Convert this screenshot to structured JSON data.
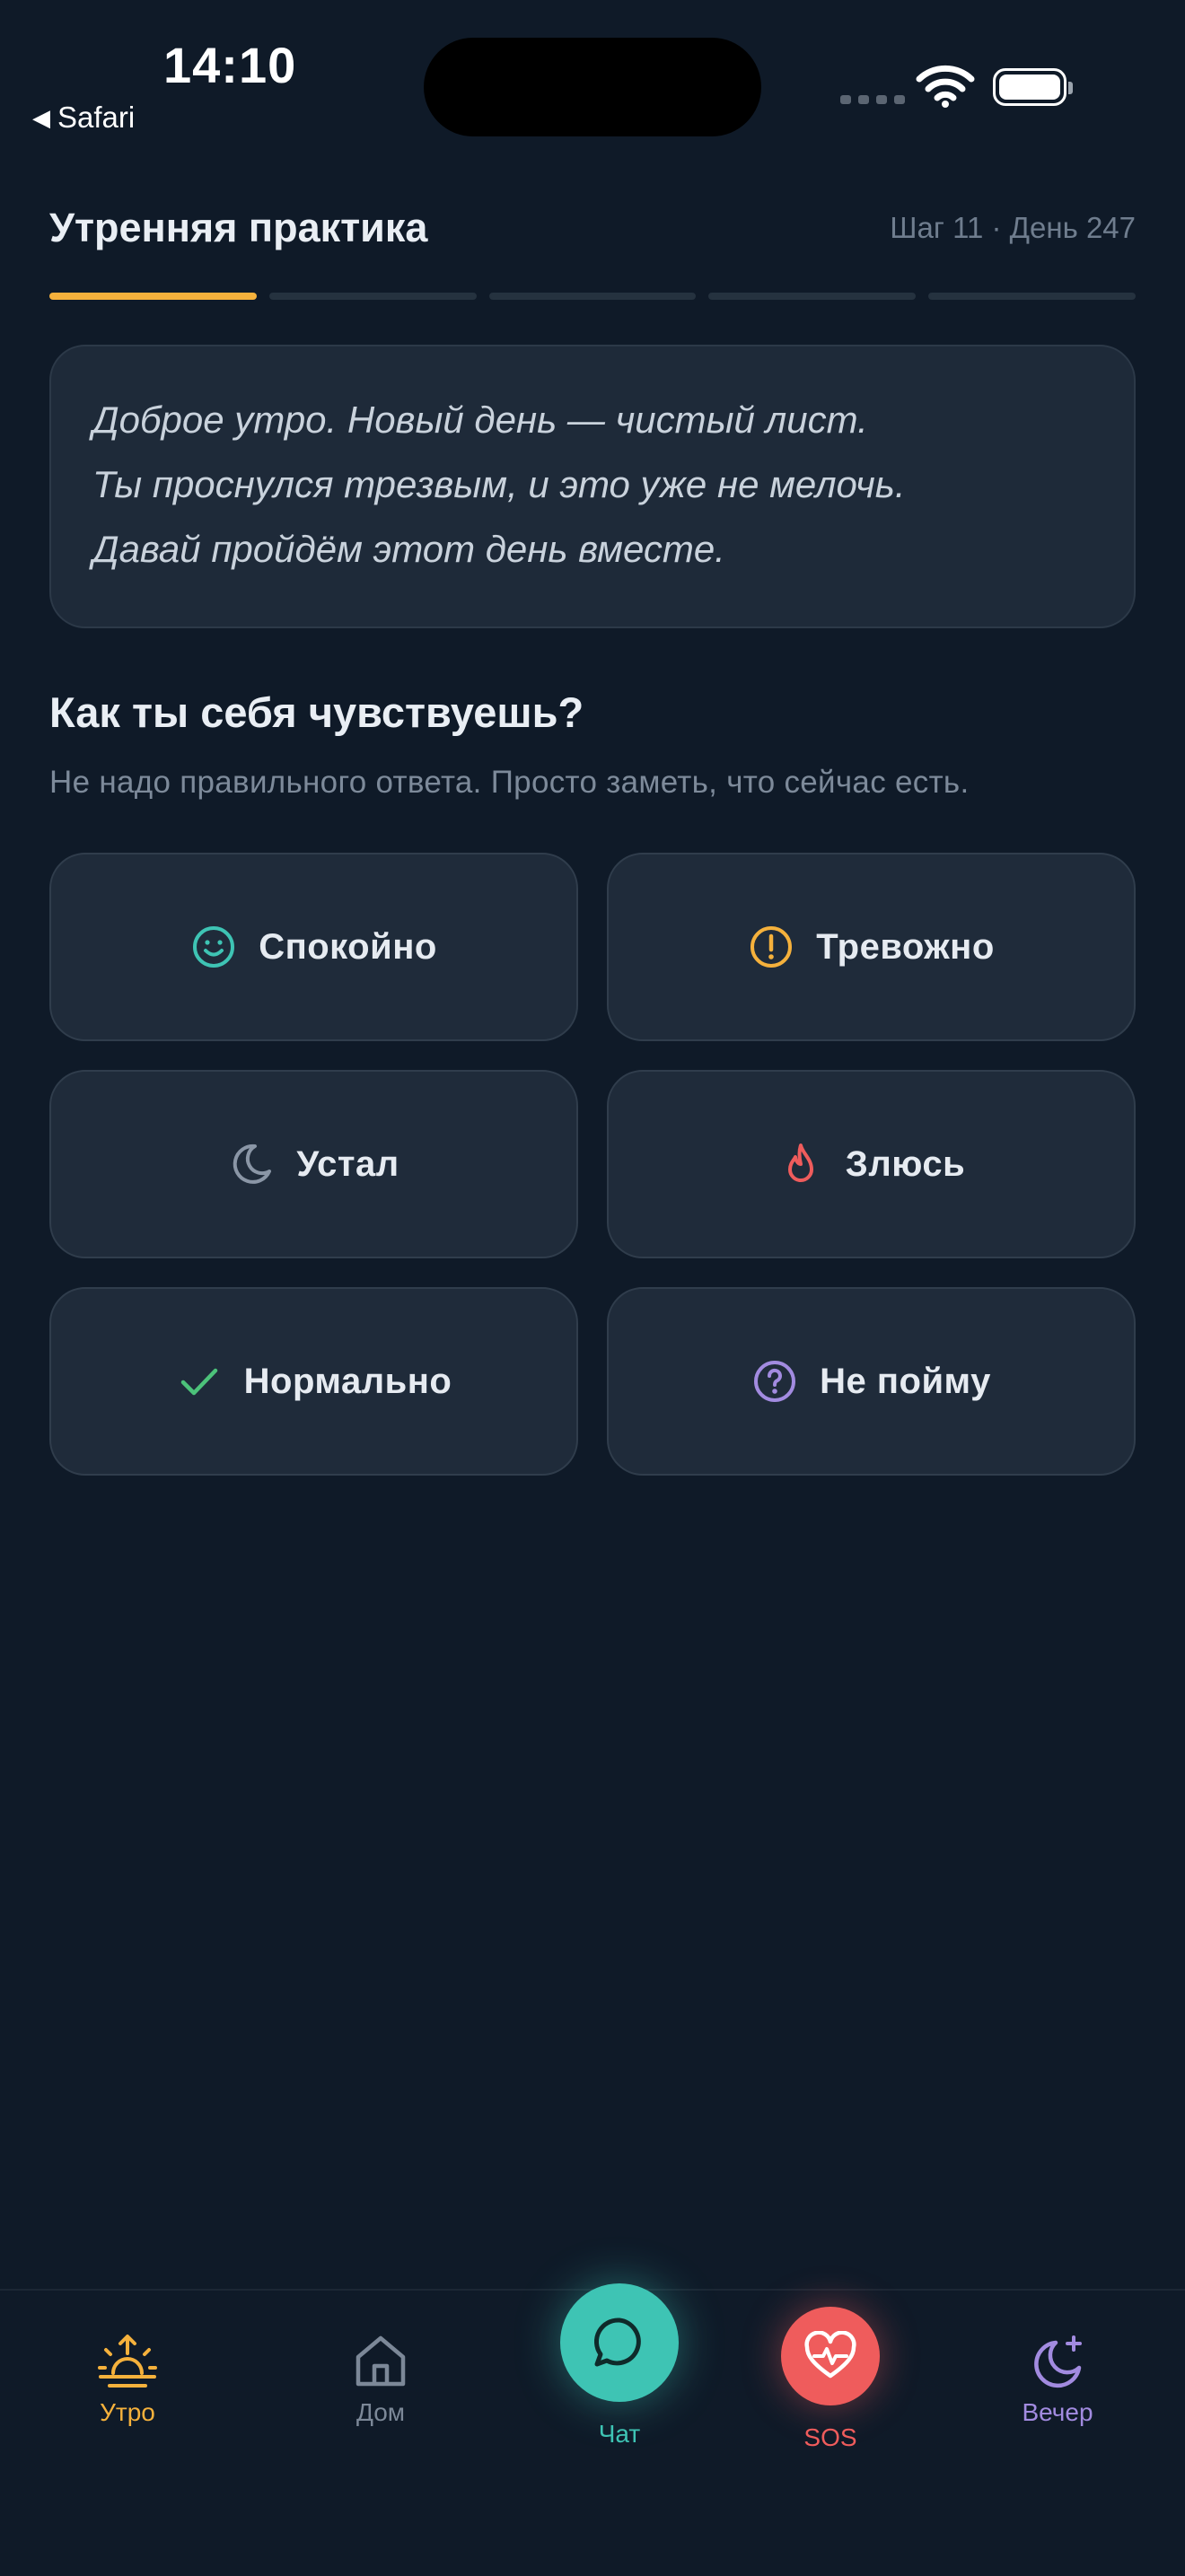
{
  "status_bar": {
    "time": "14:10",
    "back_app": "Safari"
  },
  "header": {
    "title": "Утренняя практика",
    "step_info": "Шаг 11 · День 247",
    "progress": {
      "total_segments": 5,
      "active_segments": 1,
      "active_color": "#f5b13c"
    }
  },
  "greeting": {
    "lines": [
      "Доброе утро. Новый день — чистый лист.",
      "Ты проснулся трезвым, и это уже не мелочь.",
      "Давай пройдём этот день вместе."
    ]
  },
  "question": {
    "title": "Как ты себя чувствуешь?",
    "hint": "Не надо правильного ответа. Просто заметь, что сейчас есть."
  },
  "moods": [
    {
      "label": "Спокойно",
      "icon": "smile-icon",
      "color": "#3ec4b4"
    },
    {
      "label": "Тревожно",
      "icon": "alert-circle-icon",
      "color": "#f5b13c"
    },
    {
      "label": "Устал",
      "icon": "moon-icon",
      "color": "#8a96a6"
    },
    {
      "label": "Злюсь",
      "icon": "flame-icon",
      "color": "#ef5c5c"
    },
    {
      "label": "Нормально",
      "icon": "check-icon",
      "color": "#4cc27a"
    },
    {
      "label": "Не пойму",
      "icon": "question-circle-icon",
      "color": "#a28be0"
    }
  ],
  "nav": {
    "morning": {
      "label": "Утро",
      "icon": "sunrise-icon",
      "color": "#f5b13c"
    },
    "home": {
      "label": "Дом",
      "icon": "home-icon",
      "color": "#7c8898"
    },
    "chat": {
      "label": "Чат",
      "icon": "chat-bubble-icon",
      "color": "#3ec4b4"
    },
    "sos": {
      "label": "SOS",
      "icon": "heart-pulse-icon",
      "color": "#ef5c5c"
    },
    "evening": {
      "label": "Вечер",
      "icon": "moon-star-icon",
      "color": "#a28be0"
    }
  }
}
